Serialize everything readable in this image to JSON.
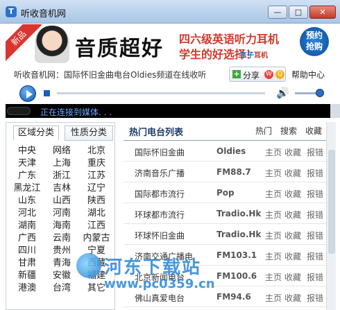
{
  "window": {
    "title": "听收音机网",
    "icon_letter": "T",
    "min": "—",
    "max": "□",
    "close": "✕"
  },
  "banner": {
    "ribbon": "新品",
    "headline": "音质超好",
    "line1": "四六级英语听力耳机",
    "line2": "学生的好选择！",
    "brand_prefix": "东子",
    "brand_suffix": "耳机",
    "badge": [
      "预约",
      "抢购"
    ]
  },
  "info": {
    "text": "听收音机网：国际怀旧金曲电台Oldies频道在线收听",
    "share": "分享",
    "help": "帮助中心"
  },
  "player": {
    "volume_icon": "🔊",
    "progress": 0,
    "volume": 0.75
  },
  "status": {
    "text": "正在连接到媒体. . ."
  },
  "left": {
    "tabs": [
      "区域分类",
      "性质分类"
    ],
    "regions": [
      [
        "中央",
        "网络",
        "北京"
      ],
      [
        "天津",
        "上海",
        "重庆"
      ],
      [
        "广东",
        "浙江",
        "江苏"
      ],
      [
        "黑龙江",
        "吉林",
        "辽宁"
      ],
      [
        "山东",
        "山西",
        "陕西"
      ],
      [
        "河北",
        "河南",
        "湖北"
      ],
      [
        "湖南",
        "海南",
        "江西"
      ],
      [
        "广西",
        "云南",
        "内蒙古"
      ],
      [
        "四川",
        "贵州",
        "宁夏"
      ],
      [
        "甘肃",
        "青海",
        "西藏"
      ],
      [
        "新疆",
        "安徽",
        "福建"
      ],
      [
        "港澳",
        "台湾",
        "其它"
      ]
    ]
  },
  "right": {
    "title": "热门电台列表",
    "links": [
      "热门",
      "搜索",
      "收藏"
    ],
    "actions": [
      "主页",
      "收藏",
      "报错"
    ],
    "stations": [
      {
        "name": "国际怀旧金曲",
        "freq": "Oldies"
      },
      {
        "name": "济南音乐广播",
        "freq": "FM88.7"
      },
      {
        "name": "国际都市流行",
        "freq": "Pop"
      },
      {
        "name": "环球都市流行",
        "freq": "Tradio.Hk"
      },
      {
        "name": "环球怀旧金曲",
        "freq": "Tradio.Hk"
      },
      {
        "name": "济南交通广播电",
        "freq": "FM103.1"
      },
      {
        "name": "北京新闻电台",
        "freq": "FM100.6"
      },
      {
        "name": "佛山真爱电台",
        "freq": "FM94.6"
      }
    ]
  },
  "watermark": {
    "name": "河东下载站",
    "url": "www.pc0359.cn"
  }
}
